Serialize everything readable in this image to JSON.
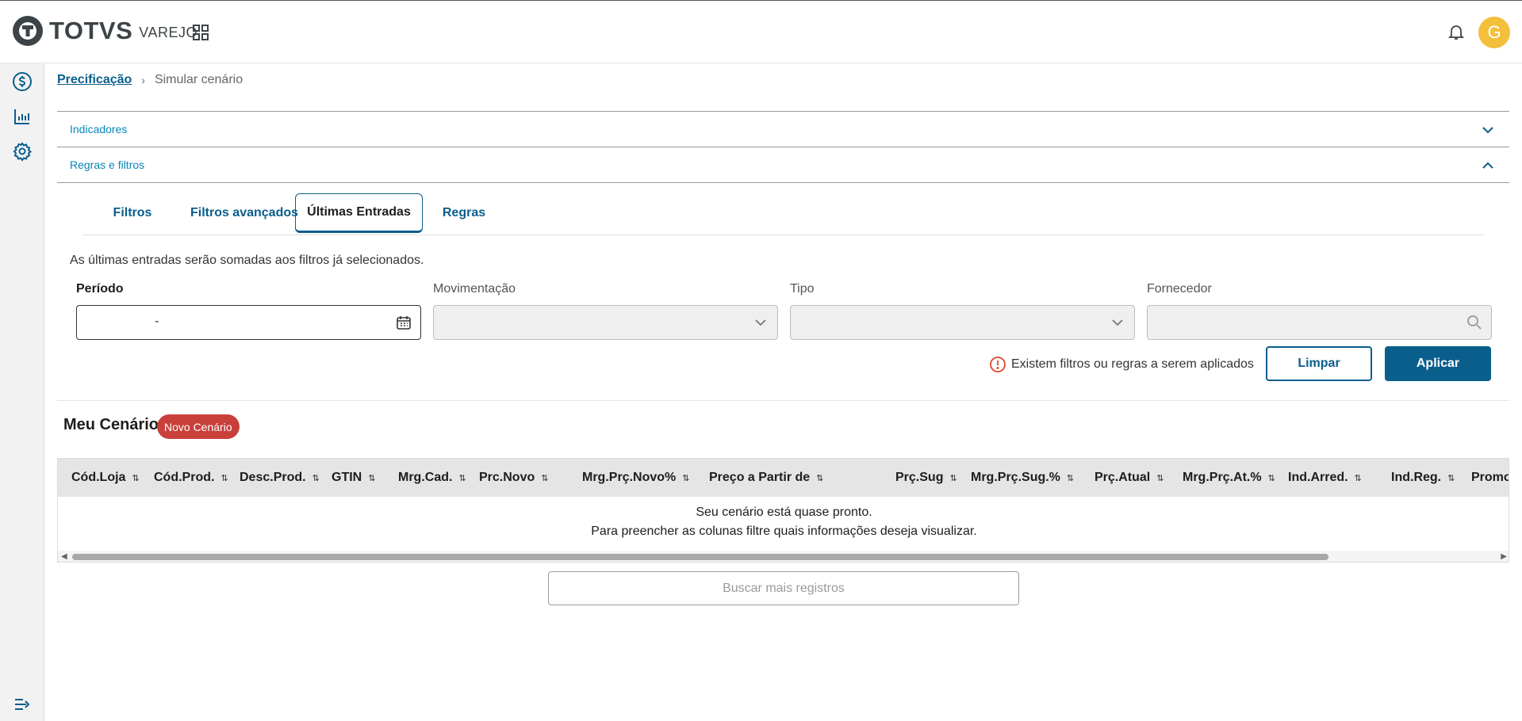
{
  "brand": {
    "name": "TOTVS",
    "product": "VAREJO"
  },
  "header": {
    "avatar_initial": "G",
    "avatar_color": "#f4bf3b"
  },
  "sidebar": {
    "items": [
      "dollar-icon",
      "chart-icon",
      "gear-icon"
    ],
    "collapse_icon": "expand-menu-icon"
  },
  "breadcrumb": {
    "root": "Precificação",
    "current": "Simular cenário"
  },
  "accordion": {
    "indicators": "Indicadores",
    "rules_filters": "Regras e filtros"
  },
  "tabs": [
    "Filtros",
    "Filtros avançados",
    "Últimas Entradas",
    "Regras"
  ],
  "active_tab": "Últimas Entradas",
  "info_text": "As últimas entradas serão somadas aos filtros já selecionados.",
  "fields": {
    "periodo": {
      "label": "Período",
      "value": "-"
    },
    "movimentacao": {
      "label": "Movimentação",
      "value": ""
    },
    "tipo": {
      "label": "Tipo",
      "value": ""
    },
    "fornecedor": {
      "label": "Fornecedor",
      "value": ""
    }
  },
  "warning": "Existem filtros ou regras a serem aplicados",
  "buttons": {
    "clear": "Limpar",
    "apply": "Aplicar",
    "more": "Buscar mais registros"
  },
  "scenario": {
    "title": "Meu Cenário",
    "badge": "Novo Cenário",
    "badge_color": "#c9403a"
  },
  "table": {
    "columns": [
      "Cód.Loja",
      "Cód.Prod.",
      "Desc.Prod.",
      "GTIN",
      "Mrg.Cad.",
      "Prc.Novo",
      "Mrg.Prç.Novo%",
      "Preço a Partir de",
      "Prç.Sug",
      "Mrg.Prç.Sug.%",
      "Prç.Atual",
      "Mrg.Prç.At.%",
      "Ind.Arred.",
      "Ind.Reg.",
      "Promoç"
    ],
    "empty_line1": "Seu cenário está quase pronto.",
    "empty_line2": "Para preencher as colunas filtre quais informações deseja visualizar."
  },
  "colors": {
    "primary": "#0a5e8c",
    "link": "#0a86b7"
  }
}
